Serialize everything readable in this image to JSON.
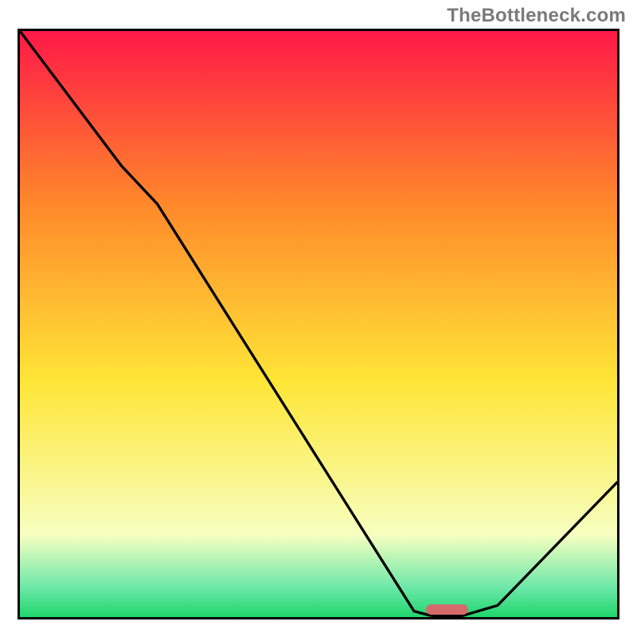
{
  "watermark": "TheBottleneck.com",
  "chart_data": {
    "type": "line",
    "title": "",
    "xlabel": "",
    "ylabel": "",
    "xlim": [
      0,
      100
    ],
    "ylim": [
      0,
      100
    ],
    "grid": false,
    "legend": false,
    "series": [
      {
        "name": "bottleneck-curve",
        "x": [
          0.0,
          17.0,
          23.0,
          66.0,
          69.0,
          74.0,
          80.0,
          100.0
        ],
        "y": [
          100.0,
          77.0,
          70.5,
          1.0,
          0.2,
          0.2,
          2.0,
          23.0
        ]
      }
    ],
    "marker": {
      "name": "optimal-marker",
      "x": 71.5,
      "width_pct": 7.0,
      "height_pct": 1.8,
      "color": "#d46a6a"
    },
    "background_gradient": {
      "top_red": "#ff1947",
      "mid_orange": "#ff8a2a",
      "mid_yellow": "#ffe637",
      "pale": "#f6ffc0",
      "low_teal": "#6be8a8",
      "green": "#1fd66a"
    }
  }
}
